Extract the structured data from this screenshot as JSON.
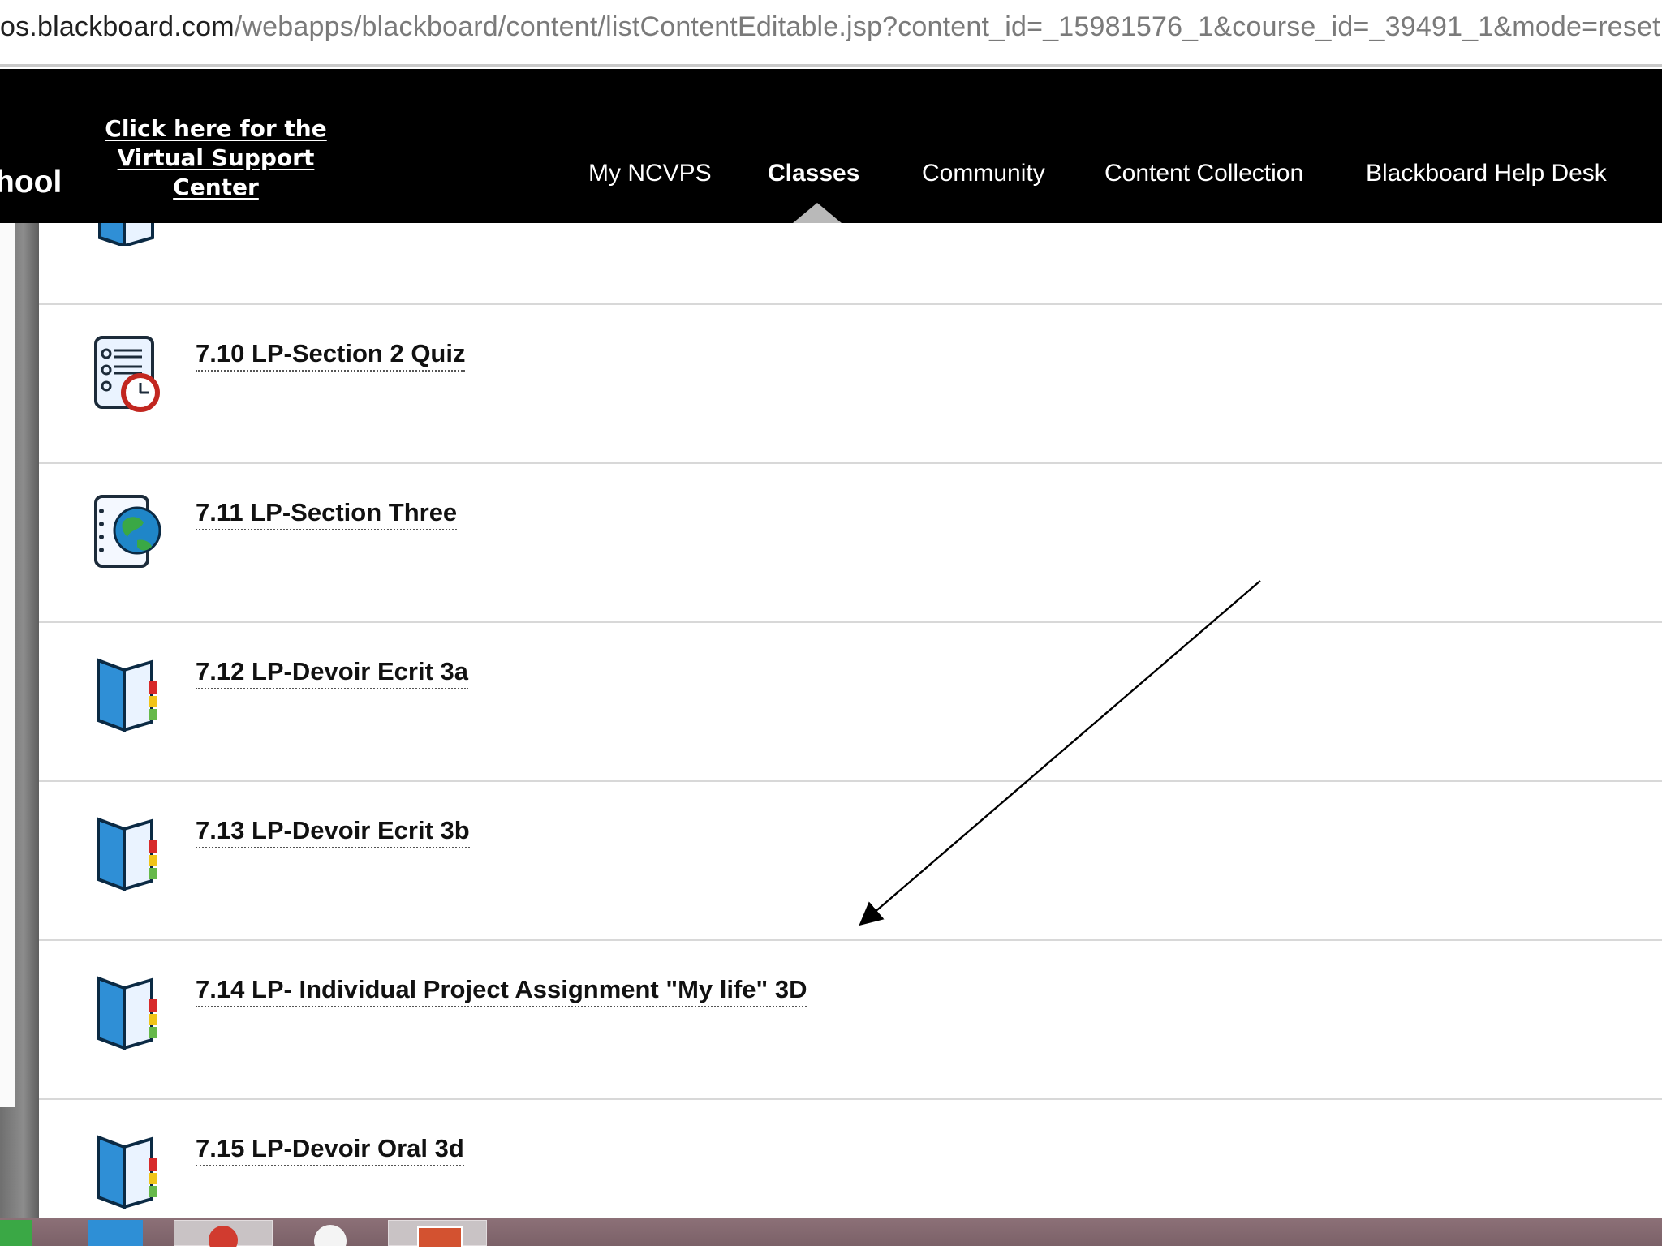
{
  "browser": {
    "url_host": "os.blackboard.com",
    "url_path": "/webapps/blackboard/content/listContentEditable.jsp?content_id=_15981576_1&course_id=_39491_1&mode=reset"
  },
  "header": {
    "brand_fragment": "hool",
    "support_line1": "Click here for the",
    "support_line2": "Virtual Support Center",
    "nav": [
      {
        "label": "My NCVPS"
      },
      {
        "label": "Classes",
        "active": true
      },
      {
        "label": "Community"
      },
      {
        "label": "Content Collection"
      },
      {
        "label": "Blackboard Help Desk"
      }
    ]
  },
  "content": {
    "items": [
      {
        "title": "7.10 LP-Section 2 Quiz",
        "icon": "quiz-icon"
      },
      {
        "title": "7.11 LP-Section Three",
        "icon": "globe-lesson-icon"
      },
      {
        "title": "7.12 LP-Devoir Ecrit 3a",
        "icon": "assignment-book-icon"
      },
      {
        "title": "7.13 LP-Devoir Ecrit 3b",
        "icon": "assignment-book-icon"
      },
      {
        "title": "7.14 LP- Individual Project Assignment \"My life\" 3D",
        "icon": "assignment-book-icon"
      },
      {
        "title": "7.15 LP-Devoir Oral 3d",
        "icon": "assignment-book-icon"
      }
    ]
  },
  "colors": {
    "header_bg": "#000000",
    "nav_text": "#ffffff",
    "divider": "#d8d8d8",
    "book_blue": "#2f8fd6"
  }
}
